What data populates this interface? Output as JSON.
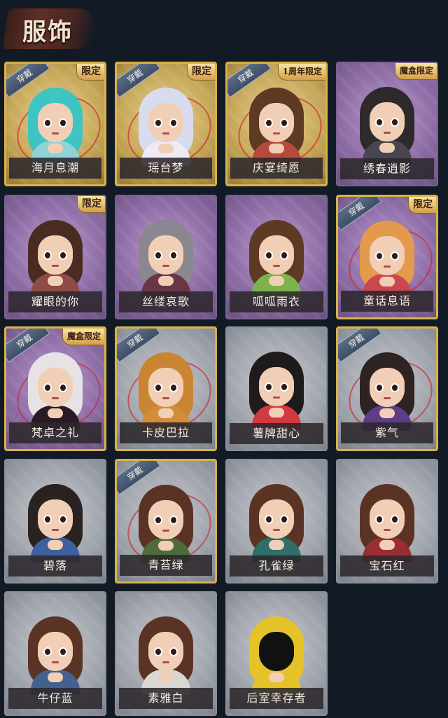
{
  "section_title": "服饰",
  "equip_label": "穿戴",
  "costumes": [
    {
      "name": "海月息潮",
      "frame": "gold",
      "equipped": true,
      "badge": "限定",
      "theme": "c-teal"
    },
    {
      "name": "瑶台梦",
      "frame": "gold",
      "equipped": true,
      "badge": "限定",
      "theme": "c-white"
    },
    {
      "name": "庆宴绮愿",
      "frame": "gold",
      "equipped": true,
      "badge": "1周年限定",
      "theme": "c-brown"
    },
    {
      "name": "绣春逍影",
      "frame": "purple",
      "equipped": false,
      "badge": "魔盒限定",
      "theme": "c-dark"
    },
    {
      "name": "耀眼的你",
      "frame": "purple",
      "equipped": false,
      "badge": "限定",
      "theme": "c-cowboy"
    },
    {
      "name": "丝缕哀歌",
      "frame": "purple",
      "equipped": false,
      "badge": "",
      "theme": "c-silver"
    },
    {
      "name": "呱呱雨衣",
      "frame": "purple",
      "equipped": false,
      "badge": "",
      "theme": "c-frog"
    },
    {
      "name": "童话息语",
      "frame": "purple",
      "equipped": true,
      "badge": "限定",
      "theme": "c-ginger"
    },
    {
      "name": "梵卓之礼",
      "frame": "purple",
      "equipped": true,
      "badge": "魔盒限定",
      "theme": "c-bw"
    },
    {
      "name": "卡皮巴拉",
      "frame": "gray",
      "equipped": true,
      "badge": "",
      "theme": "c-capy"
    },
    {
      "name": "薯牌甜心",
      "frame": "gray",
      "equipped": false,
      "badge": "",
      "theme": "c-chips"
    },
    {
      "name": "紫气",
      "frame": "gray",
      "equipped": true,
      "badge": "",
      "theme": "c-purple"
    },
    {
      "name": "碧落",
      "frame": "gray",
      "equipped": false,
      "badge": "",
      "theme": "c-blue"
    },
    {
      "name": "青苔绿",
      "frame": "gray",
      "equipped": true,
      "badge": "",
      "theme": "c-green"
    },
    {
      "name": "孔雀绿",
      "frame": "gray",
      "equipped": false,
      "badge": "",
      "theme": "c-peacock"
    },
    {
      "name": "宝石红",
      "frame": "gray",
      "equipped": false,
      "badge": "",
      "theme": "c-ruby"
    },
    {
      "name": "牛仔蓝",
      "frame": "gray",
      "equipped": false,
      "badge": "",
      "theme": "c-denim"
    },
    {
      "name": "素雅白",
      "frame": "gray",
      "equipped": false,
      "badge": "",
      "theme": "c-plainwhite"
    },
    {
      "name": "后室幸存者",
      "frame": "gray",
      "equipped": false,
      "badge": "",
      "theme": "c-suit"
    }
  ]
}
